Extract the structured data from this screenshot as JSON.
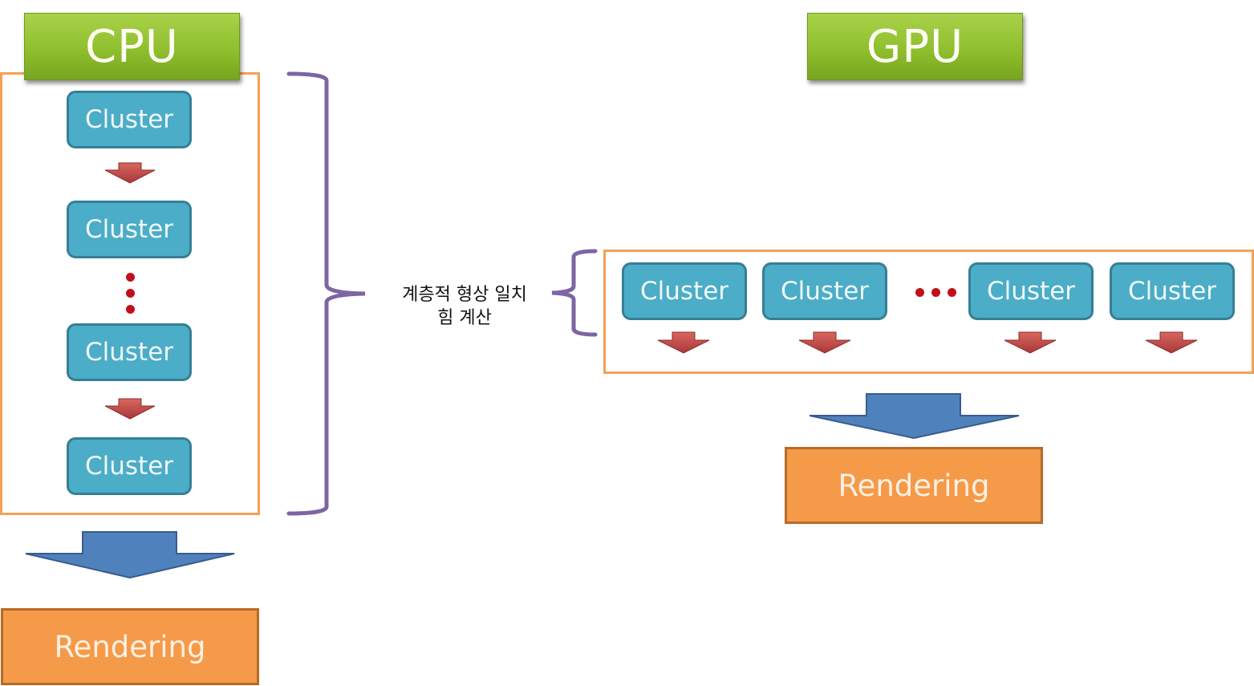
{
  "cpu": {
    "title": "CPU",
    "clusters": [
      "Cluster",
      "Cluster",
      "Cluster",
      "Cluster"
    ],
    "rendering_label": "Rendering"
  },
  "gpu": {
    "title": "GPU",
    "clusters": [
      "Cluster",
      "Cluster",
      "Cluster",
      "Cluster"
    ],
    "rendering_label": "Rendering"
  },
  "bracket_label": {
    "line1": "계층적 형상 일치",
    "line2": "힘 계산"
  },
  "colors": {
    "title_green": "#8fbf2e",
    "cluster_blue": "#4badc7",
    "frame_orange": "#f4a156",
    "rendering_orange": "#f59a48",
    "bracket_purple": "#7d65a4",
    "small_arrow_red": "#c0504d",
    "big_arrow_blue": "#4f81bd",
    "ellipsis_red": "#c0101a"
  }
}
